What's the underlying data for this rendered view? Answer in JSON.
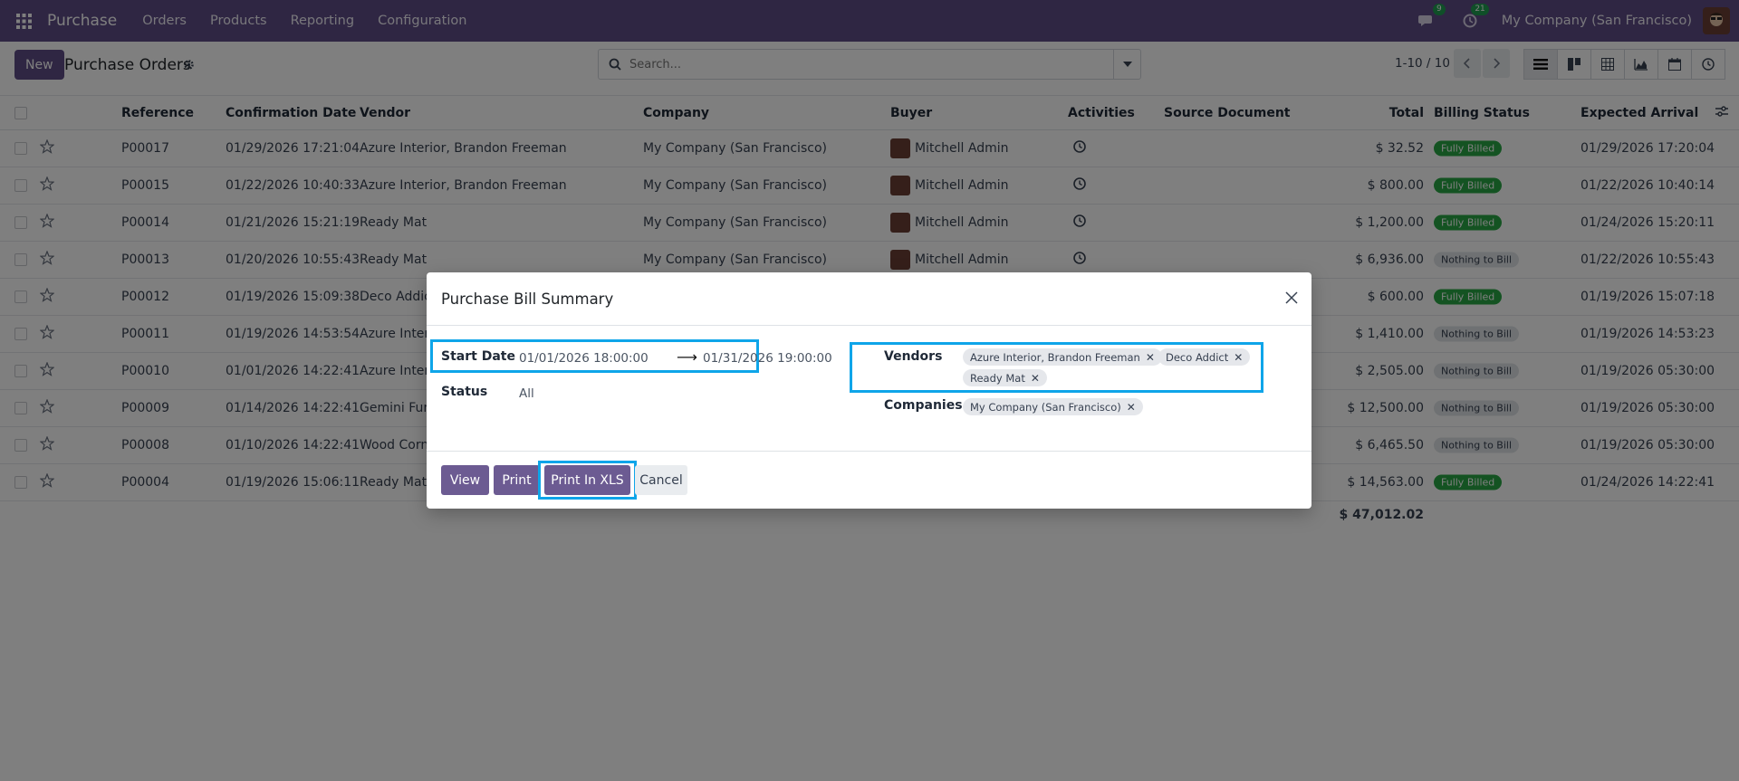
{
  "navbar": {
    "brand": "Purchase",
    "menu": [
      "Orders",
      "Products",
      "Reporting",
      "Configuration"
    ],
    "messages_count": "9",
    "activities_count": "21",
    "company": "My Company (San Francisco)"
  },
  "control": {
    "new_label": "New",
    "title": "Purchase Orders",
    "search_placeholder": "Search...",
    "pager": "1-10 / 10"
  },
  "list": {
    "columns": [
      "Reference",
      "Confirmation Date",
      "Vendor",
      "Company",
      "Buyer",
      "Activities",
      "Source Document",
      "Total",
      "Billing Status",
      "Expected Arrival"
    ],
    "rows": [
      {
        "ref": "P00017",
        "date": "01/29/2026 17:21:04",
        "vendor": "Azure Interior, Brandon Freeman",
        "company": "My Company (San Francisco)",
        "buyer": "Mitchell Admin",
        "total": "$ 32.52",
        "status": "Fully Billed",
        "status_type": "green",
        "arrival": "01/29/2026 17:20:04"
      },
      {
        "ref": "P00015",
        "date": "01/22/2026 10:40:33",
        "vendor": "Azure Interior, Brandon Freeman",
        "company": "My Company (San Francisco)",
        "buyer": "Mitchell Admin",
        "total": "$ 800.00",
        "status": "Fully Billed",
        "status_type": "green",
        "arrival": "01/22/2026 10:40:14"
      },
      {
        "ref": "P00014",
        "date": "01/21/2026 15:21:19",
        "vendor": "Ready Mat",
        "company": "My Company (San Francisco)",
        "buyer": "Mitchell Admin",
        "total": "$ 1,200.00",
        "status": "Fully Billed",
        "status_type": "green",
        "arrival": "01/24/2026 15:20:11"
      },
      {
        "ref": "P00013",
        "date": "01/20/2026 10:55:43",
        "vendor": "Ready Mat",
        "company": "My Company (San Francisco)",
        "buyer": "Mitchell Admin",
        "total": "$ 6,936.00",
        "status": "Nothing to Bill",
        "status_type": "gray",
        "arrival": "01/22/2026 10:55:43"
      },
      {
        "ref": "P00012",
        "date": "01/19/2026 15:09:38",
        "vendor": "Deco Addict",
        "company": "",
        "buyer": "",
        "total": "$ 600.00",
        "status": "Fully Billed",
        "status_type": "green",
        "arrival": "01/19/2026 15:07:18"
      },
      {
        "ref": "P00011",
        "date": "01/19/2026 14:53:54",
        "vendor": "Azure Interi",
        "company": "",
        "buyer": "",
        "total": "$ 1,410.00",
        "status": "Nothing to Bill",
        "status_type": "gray",
        "arrival": "01/19/2026 14:53:23"
      },
      {
        "ref": "P00010",
        "date": "01/01/2026 14:22:41",
        "vendor": "Azure Interi",
        "company": "",
        "buyer": "",
        "total": "$ 2,505.00",
        "status": "Nothing to Bill",
        "status_type": "gray",
        "arrival": "01/19/2026 05:30:00"
      },
      {
        "ref": "P00009",
        "date": "01/14/2026 14:22:41",
        "vendor": "Gemini Furn",
        "company": "",
        "buyer": "",
        "total": "$ 12,500.00",
        "status": "Nothing to Bill",
        "status_type": "gray",
        "arrival": "01/19/2026 05:30:00"
      },
      {
        "ref": "P00008",
        "date": "01/10/2026 14:22:41",
        "vendor": "Wood Corne",
        "company": "",
        "buyer": "",
        "total": "$ 6,465.50",
        "status": "Nothing to Bill",
        "status_type": "gray",
        "arrival": "01/19/2026 05:30:00"
      },
      {
        "ref": "P00004",
        "date": "01/19/2026 15:06:11",
        "vendor": "Ready Mat",
        "company": "",
        "buyer": "",
        "total": "$ 14,563.00",
        "status": "Fully Billed",
        "status_type": "green",
        "arrival": "01/24/2026 14:22:41"
      }
    ],
    "grand_total": "$ 47,012.02"
  },
  "modal": {
    "title": "Purchase Bill Summary",
    "start_date_label": "Start Date",
    "start_date": "01/01/2026 18:00:00",
    "end_date": "01/31/2026 19:00:00",
    "arrow": "⟶",
    "status_label": "Status",
    "status_value": "All",
    "vendors_label": "Vendors",
    "vendors": [
      "Azure Interior, Brandon Freeman",
      "Deco Addict",
      "Ready Mat"
    ],
    "companies_label": "Companies",
    "companies": [
      "My Company (San Francisco)"
    ],
    "buttons": {
      "view": "View",
      "print": "Print",
      "print_xls": "Print In XLS",
      "cancel": "Cancel"
    }
  },
  "colors": {
    "navbar": "#5e4c87",
    "primary": "#6c5b92",
    "highlight": "#0ea5e9",
    "success": "#28a745"
  }
}
